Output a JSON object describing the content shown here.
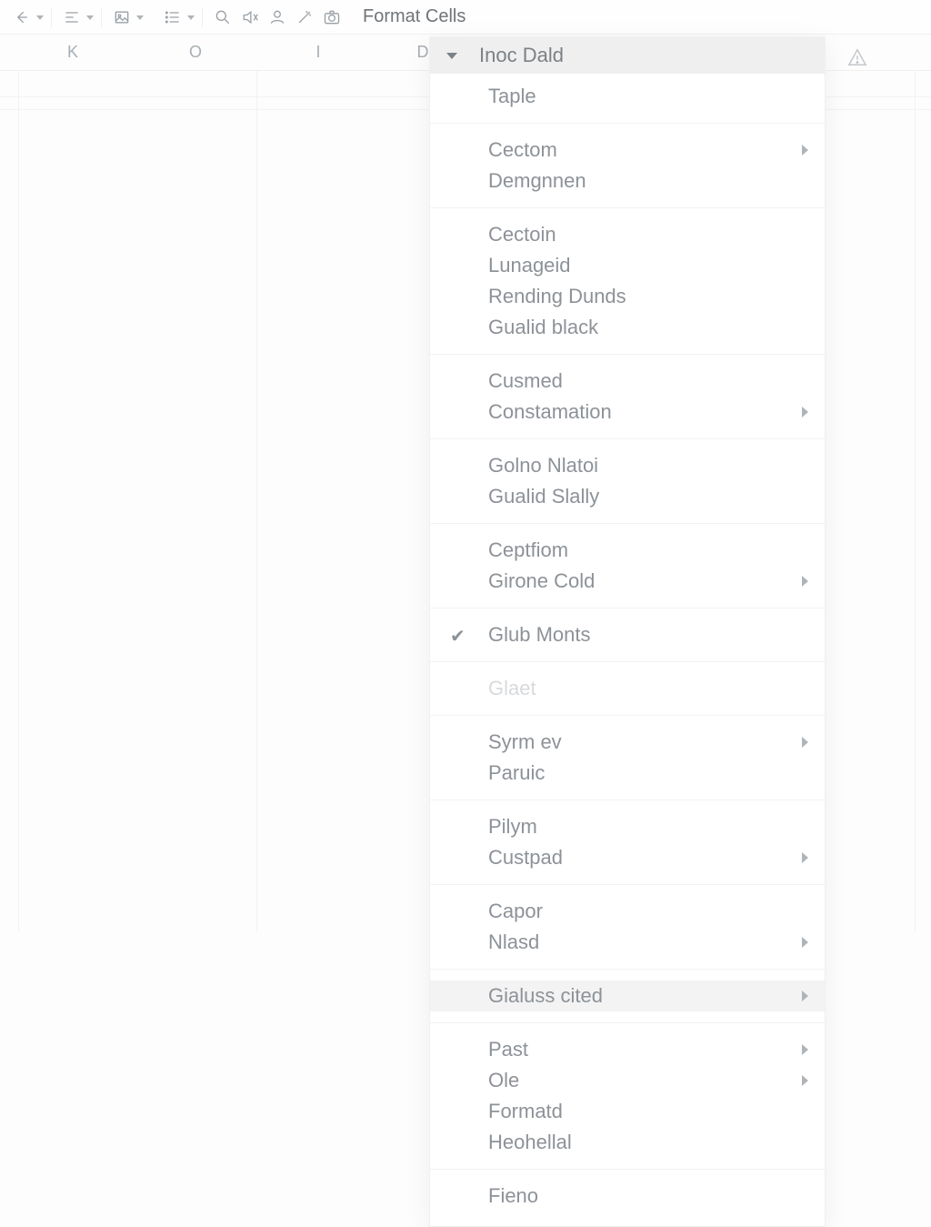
{
  "toolbar": {
    "menu_title": "Format Cells"
  },
  "columns": [
    "K",
    "O",
    "I",
    "D"
  ],
  "dropdown": {
    "header": "Inoc Dald",
    "groups": [
      [
        {
          "label": "Taple",
          "submenu": false,
          "checked": false,
          "disabled": false
        }
      ],
      [
        {
          "label": "Cectom",
          "submenu": true,
          "checked": false,
          "disabled": false
        },
        {
          "label": "Demgnnen",
          "submenu": false,
          "checked": false,
          "disabled": false
        }
      ],
      [
        {
          "label": "Cectoin",
          "submenu": false,
          "checked": false,
          "disabled": false
        },
        {
          "label": "Lunageid",
          "submenu": false,
          "checked": false,
          "disabled": false
        },
        {
          "label": "Rending Dunds",
          "submenu": false,
          "checked": false,
          "disabled": false
        },
        {
          "label": "Gualid black",
          "submenu": false,
          "checked": false,
          "disabled": false
        }
      ],
      [
        {
          "label": "Cusmed",
          "submenu": false,
          "checked": false,
          "disabled": false
        },
        {
          "label": "Constamation",
          "submenu": true,
          "checked": false,
          "disabled": false
        }
      ],
      [
        {
          "label": "Golno Nlatoi",
          "submenu": false,
          "checked": false,
          "disabled": false
        },
        {
          "label": "Gualid Slally",
          "submenu": false,
          "checked": false,
          "disabled": false
        }
      ],
      [
        {
          "label": "Ceptfiom",
          "submenu": false,
          "checked": false,
          "disabled": false
        },
        {
          "label": "Girone Cold",
          "submenu": true,
          "checked": false,
          "disabled": false
        }
      ],
      [
        {
          "label": "Glub Monts",
          "submenu": false,
          "checked": true,
          "disabled": false
        }
      ],
      [
        {
          "label": "Glaet",
          "submenu": false,
          "checked": false,
          "disabled": true
        }
      ],
      [
        {
          "label": "Syrm ev",
          "submenu": true,
          "checked": false,
          "disabled": false
        },
        {
          "label": "Paruic",
          "submenu": false,
          "checked": false,
          "disabled": false
        }
      ],
      [
        {
          "label": "Pilym",
          "submenu": false,
          "checked": false,
          "disabled": false
        },
        {
          "label": "Custpad",
          "submenu": true,
          "checked": false,
          "disabled": false
        }
      ],
      [
        {
          "label": "Capor",
          "submenu": false,
          "checked": false,
          "disabled": false
        },
        {
          "label": "Nlasd",
          "submenu": true,
          "checked": false,
          "disabled": false
        }
      ],
      [
        {
          "label": "Gialuss cited",
          "submenu": true,
          "checked": false,
          "disabled": false,
          "hover": true
        }
      ],
      [
        {
          "label": "Past",
          "submenu": true,
          "checked": false,
          "disabled": false
        },
        {
          "label": "Ole",
          "submenu": true,
          "checked": false,
          "disabled": false
        },
        {
          "label": "Formatd",
          "submenu": false,
          "checked": false,
          "disabled": false
        },
        {
          "label": "Heohellal",
          "submenu": false,
          "checked": false,
          "disabled": false
        }
      ],
      [
        {
          "label": "Fieno",
          "submenu": false,
          "checked": false,
          "disabled": false
        }
      ]
    ]
  }
}
